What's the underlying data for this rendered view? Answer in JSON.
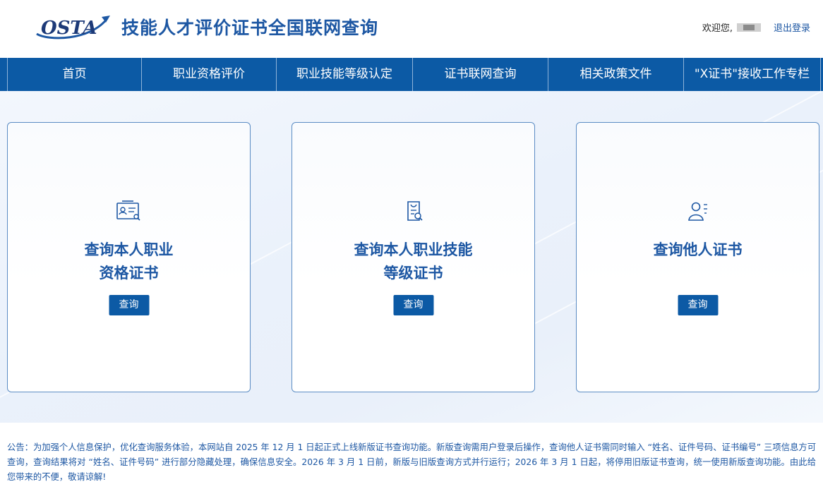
{
  "header": {
    "logo_text": "OSTA",
    "title": "技能人才评价证书全国联网查询",
    "welcome": "欢迎您,",
    "logout": "退出登录"
  },
  "nav": {
    "items": [
      {
        "label": "首页"
      },
      {
        "label": "职业资格评价"
      },
      {
        "label": "职业技能等级认定"
      },
      {
        "label": "证书联网查询"
      },
      {
        "label": "相关政策文件"
      },
      {
        "label": "\"X证书\"接收工作专栏"
      }
    ]
  },
  "cards": [
    {
      "title_line1": "查询本人职业",
      "title_line2": "资格证书",
      "button": "查询",
      "icon": "certificate-search-icon"
    },
    {
      "title_line1": "查询本人职业技能",
      "title_line2": "等级证书",
      "button": "查询",
      "icon": "document-search-icon"
    },
    {
      "title_line1": "查询他人证书",
      "title_line2": "",
      "button": "查询",
      "icon": "user-list-icon"
    }
  ],
  "notice": "公告：为加强个人信息保护，优化查询服务体验，本网站自 2025 年 12 月 1 日起正式上线新版证书查询功能。新版查询需用户登录后操作，查询他人证书需同时输入 “姓名、证件号码、证书编号” 三项信息方可查询，查询结果将对 “姓名、证件号码” 进行部分隐藏处理，确保信息安全。2026 年 3 月 1 日前，新版与旧版查询方式并行运行；2026 年 3 月 1 日起，将停用旧版证书查询，统一使用新版查询功能。由此给您带来的不便，敬请谅解!",
  "colors": {
    "primary": "#0c5aa5",
    "title": "#1d57a3"
  }
}
